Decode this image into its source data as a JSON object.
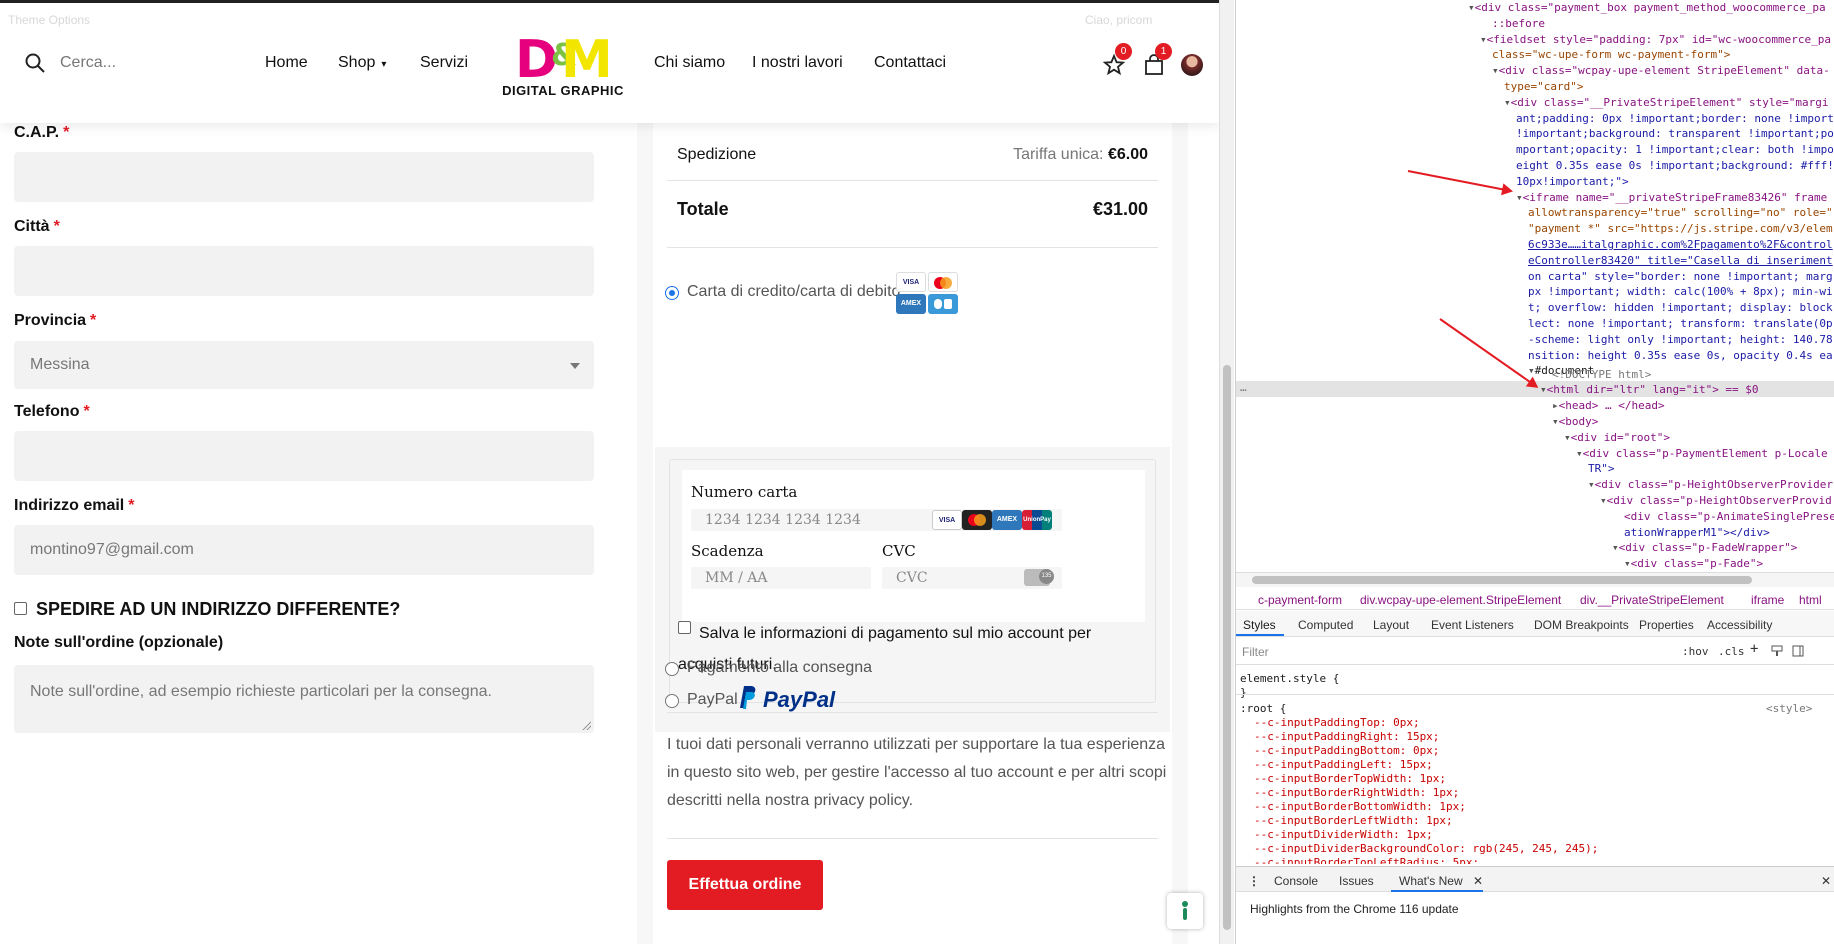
{
  "site": {
    "ghost_left": "Theme Options",
    "ghost_right": "Ciao, pricom",
    "search_placeholder": "Cerca...",
    "nav_left": [
      "Home",
      "Shop",
      "Servizi"
    ],
    "nav_right": [
      "Chi siamo",
      "I nostri lavori",
      "Contattaci"
    ],
    "logo_text": "D&M",
    "logo_tagline": "DIGITAL GRAPHIC",
    "wishlist_count": "0",
    "cart_count": "1"
  },
  "billing": {
    "cap_label": "C.A.P.",
    "city_label": "Città",
    "province_label": "Provincia",
    "province_value": "Messina",
    "phone_label": "Telefono",
    "email_label": "Indirizzo email",
    "email_value": "montino97@gmail.com",
    "required_mark": "*",
    "ship_different_label": "SPEDIRE AD UN INDIRIZZO DIFFERENTE?",
    "notes_label": "Note sull'ordine (opzionale)",
    "notes_placeholder": "Note sull'ordine, ad esempio richieste particolari per la consegna."
  },
  "summary": {
    "shipping_label": "Spedizione",
    "shipping_prefix": "Tariffa unica:",
    "shipping_value": "€6.00",
    "total_label": "Totale",
    "total_value": "€31.00",
    "card_method_label": "Carta di credito/carta di debito",
    "card_number_label": "Numero carta",
    "card_number_placeholder": "1234 1234 1234 1234",
    "expiry_label": "Scadenza",
    "expiry_placeholder": "MM / AA",
    "cvc_label": "CVC",
    "cvc_placeholder": "CVC",
    "save_info_label": "Salva le informazioni di pagamento sul mio account per acquisti futuri.",
    "cod_label": "Pagamento alla consegna",
    "paypal_label": "PayPal",
    "paypal_logo": "PayPal",
    "privacy_text": "I tuoi dati personali verranno utilizzati per supportare la tua esperienza in questo sito web, per gestire l'accesso al tuo account e per altri scopi descritti nella nostra privacy policy.",
    "order_button": "Effettua ordine",
    "brand_visa": "VISA",
    "brand_amex": "AMEX",
    "brand_unionpay": "UnionPay",
    "cvc_badge": "135"
  },
  "devtools": {
    "breadcrumbs": [
      "c-payment-form",
      "div.wcpay-upe-element.StripeElement",
      "div.__PrivateStripeElement",
      "iframe",
      "html"
    ],
    "panel_tabs": [
      "Styles",
      "Computed",
      "Layout",
      "Event Listeners",
      "DOM Breakpoints",
      "Properties",
      "Accessibility"
    ],
    "filter_placeholder": "Filter",
    "filter_hov": ":hov",
    "filter_cls": ".cls",
    "drawer_tabs": [
      "Console",
      "Issues",
      "What's New"
    ],
    "whats_new": "Highlights from the Chrome 116 update",
    "dom_lines": [
      "<div class=\"payment_box payment_method_woocommerce_pa",
      "::before",
      "<fieldset style=\"padding: 7px\" id=\"wc-woocommerce_pa",
      "class=\"wc-upe-form wc-payment-form\">",
      "<div class=\"wcpay-upe-element StripeElement\" data-",
      "type=\"card\">",
      "<div class=\"__PrivateStripeElement\" style=\"margi",
      "ant;padding: 0px !important;border: none !import",
      "!important;background: transparent !important;po",
      "mportant;opacity: 1 !important;clear: both !impo",
      "eight 0.35s ease 0s !important;background: #fff!",
      "10px!important;\">",
      "<iframe name=\"__privateStripeFrame83426\" frame",
      "allowtransparency=\"true\" scrolling=\"no\" role=\"",
      "\"payment *\" src=\"https://js.stripe.com/v3/elem",
      "6c933e……italgraphic.com%2Fpagamento%2F&control",
      "eController83420\" title=\"Casella di inseriment",
      "on carta\" style=\"border: none !important; marg",
      "px !important; width: calc(100% + 8px); min-wi",
      "t; overflow: hidden !important; display: block",
      "lect: none !important; transform: translate(0p",
      "-scheme: light only !important; height: 140.78",
      "nsition: height 0.35s ease 0s, opacity 0.4s ea",
      "#document",
      "<!DOCTYPE html>",
      "<html dir=\"ltr\" lang=\"it\"> == $0",
      "<head> … </head>",
      "<body>",
      "<div id=\"root\">",
      "<div class=\"p-PaymentElement p-Locale",
      "TR\">",
      "<div class=\"p-HeightObserverProvider",
      "<div class=\"p-HeightObserverProvid",
      "<div class=\"p-AnimateSinglePrese",
      "ationWrapperM1\"></div>",
      "<div class=\"p-FadeWrapper\">",
      "<div class=\"p-Fade\">"
    ],
    "style_lines": [
      "element.style {",
      "}",
      ":root {",
      "--c-inputPaddingTop: 0px;",
      "--c-inputPaddingRight: 15px;",
      "--c-inputPaddingBottom: 0px;",
      "--c-inputPaddingLeft: 15px;",
      "--c-inputBorderTopWidth: 1px;",
      "--c-inputBorderRightWidth: 1px;",
      "--c-inputBorderBottomWidth: 1px;",
      "--c-inputBorderLeftWidth: 1px;",
      "--c-inputDividerWidth: 1px;",
      "--c-inputDividerBackgroundColor: rgb(245, 245, 245);",
      "--c-inputBorderTopLeftRadius: 5px;"
    ],
    "style_source": "<style>"
  }
}
